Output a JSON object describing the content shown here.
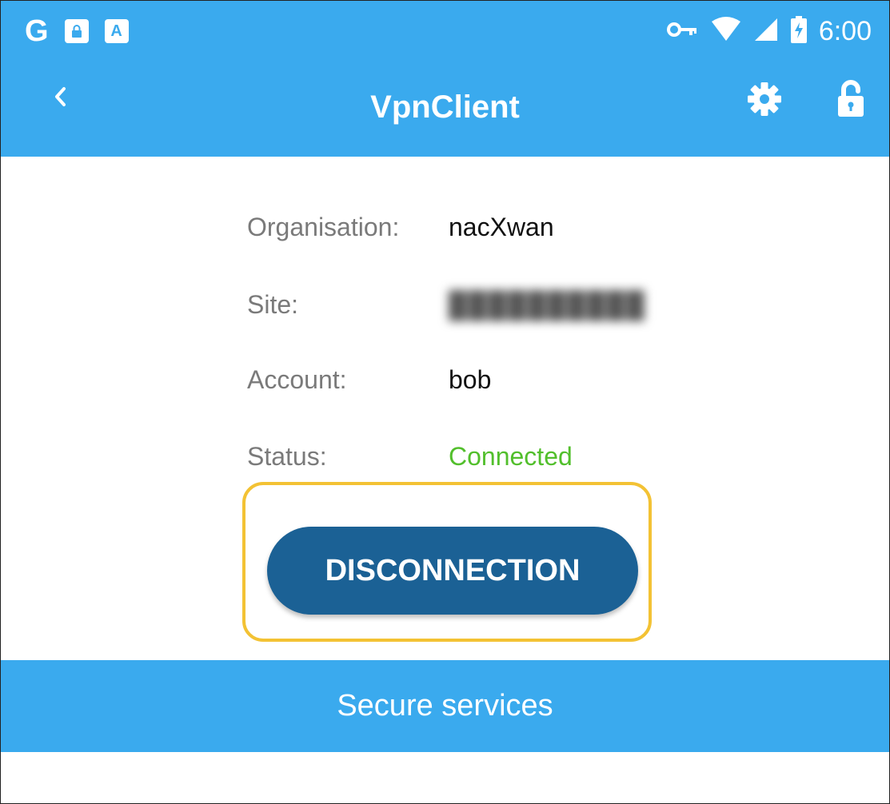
{
  "status_bar": {
    "left_icons": [
      "google-icon",
      "lock-notification-icon",
      "keyboard-a-icon"
    ],
    "google_letter": "G",
    "keyboard_letter": "A",
    "right_icons": [
      "vpn-key-icon",
      "wifi-icon",
      "signal-icon",
      "battery-charging-icon"
    ],
    "time": "6:00"
  },
  "app_bar": {
    "title": "VpnClient",
    "back_icon": "chevron-left-icon",
    "settings_icon": "gear-icon",
    "lock_icon": "unlock-icon"
  },
  "details": {
    "organisation_label": "Organisation:",
    "organisation_value": "nacXwan",
    "site_label": "Site:",
    "site_value": "██████████",
    "account_label": "Account:",
    "account_value": "bob",
    "status_label": "Status:",
    "status_value": "Connected"
  },
  "actions": {
    "disconnect_label": "DISCONNECTION"
  },
  "secure_services": {
    "title": "Secure services"
  },
  "colors": {
    "primary": "#3aaaee",
    "button": "#1b6195",
    "connected": "#52bf2c",
    "highlight": "#f3c234"
  }
}
